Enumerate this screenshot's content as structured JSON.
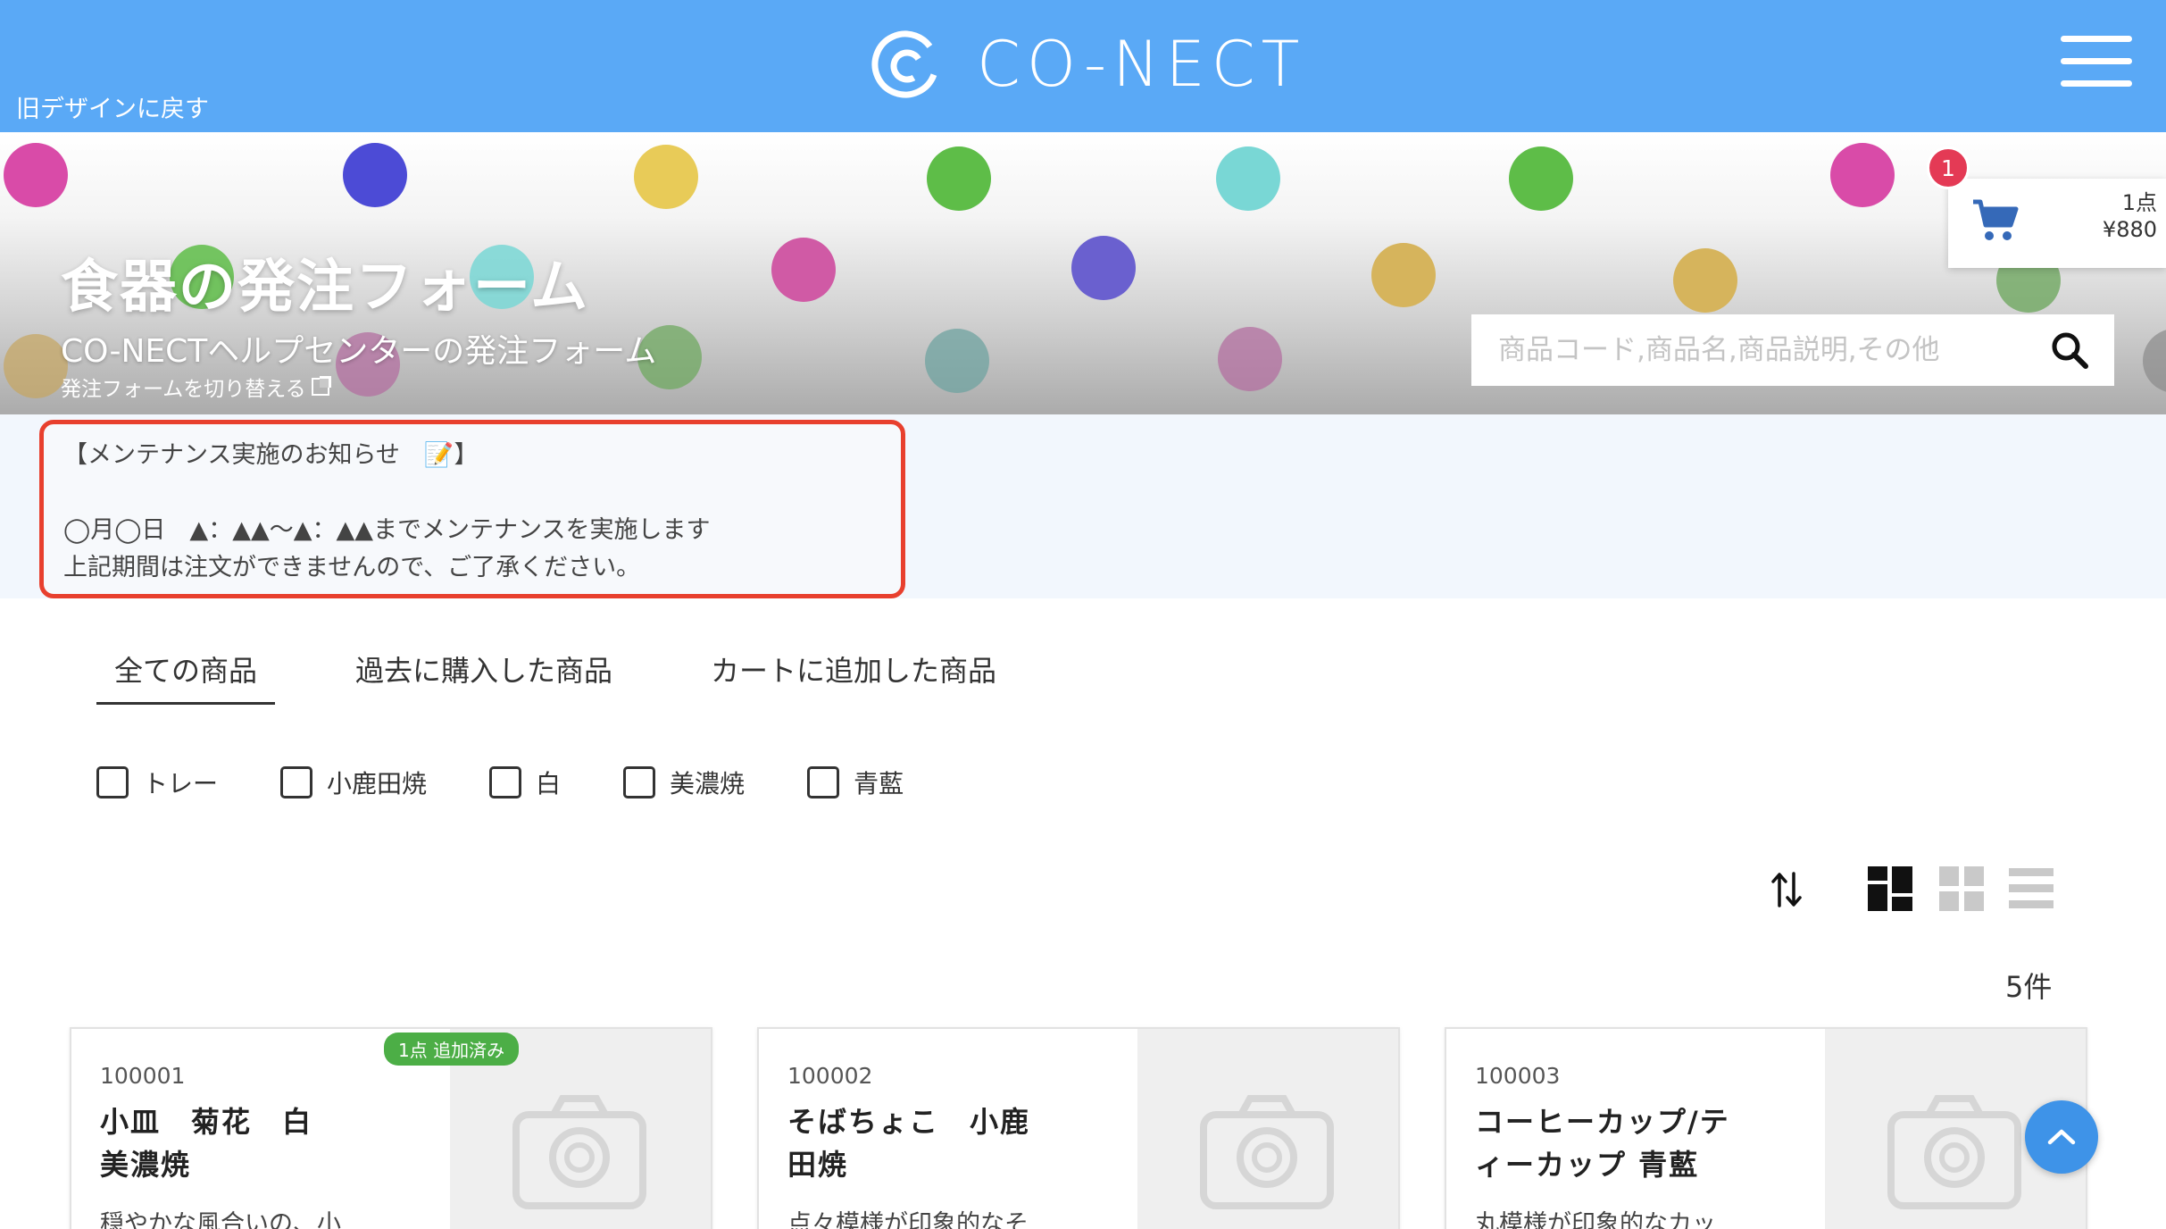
{
  "header": {
    "old_design_link": "旧デザインに戻す",
    "logo_text": "CO-NECT",
    "bg_color": "#5aa9f6"
  },
  "banner": {
    "title": "食器の発注フォーム",
    "subtitle": "CO-NECTヘルプセンターの発注フォーム",
    "switch_link": "発注フォームを切り替える"
  },
  "search": {
    "placeholder": "商品コード,商品名,商品説明,その他",
    "value": ""
  },
  "cart": {
    "badge": "1",
    "items": "1点",
    "total": "¥880"
  },
  "notice": {
    "line1": "【メンテナンス実施のお知らせ　📝】",
    "line2": "",
    "line3": "◯月◯日　▲：▲▲〜▲：▲▲までメンテナンスを実施します",
    "line4": "上記期間は注文ができませんので、ご了承ください。"
  },
  "tabs": [
    {
      "label": "全ての商品",
      "active": true
    },
    {
      "label": "過去に購入した商品",
      "active": false
    },
    {
      "label": "カートに追加した商品",
      "active": false
    }
  ],
  "filters": [
    {
      "label": "トレー",
      "checked": false
    },
    {
      "label": "小鹿田焼",
      "checked": false
    },
    {
      "label": "白",
      "checked": false
    },
    {
      "label": "美濃焼",
      "checked": false
    },
    {
      "label": "青藍",
      "checked": false
    }
  ],
  "result_count": "5件",
  "products": [
    {
      "code": "100001",
      "name_line1": "小皿　菊花　白",
      "name_line2": "美濃焼",
      "desc": "穏やかな風合いの、小",
      "badge": "1点 追加済み"
    },
    {
      "code": "100002",
      "name_line1": "そばちょこ　小鹿",
      "name_line2": "田焼",
      "desc": "点々模様が印象的なそ",
      "badge": ""
    },
    {
      "code": "100003",
      "name_line1": "コーヒーカップ/テ",
      "name_line2": "ィーカップ 青藍",
      "desc": "丸模様が印象的なカッ",
      "badge": ""
    }
  ]
}
